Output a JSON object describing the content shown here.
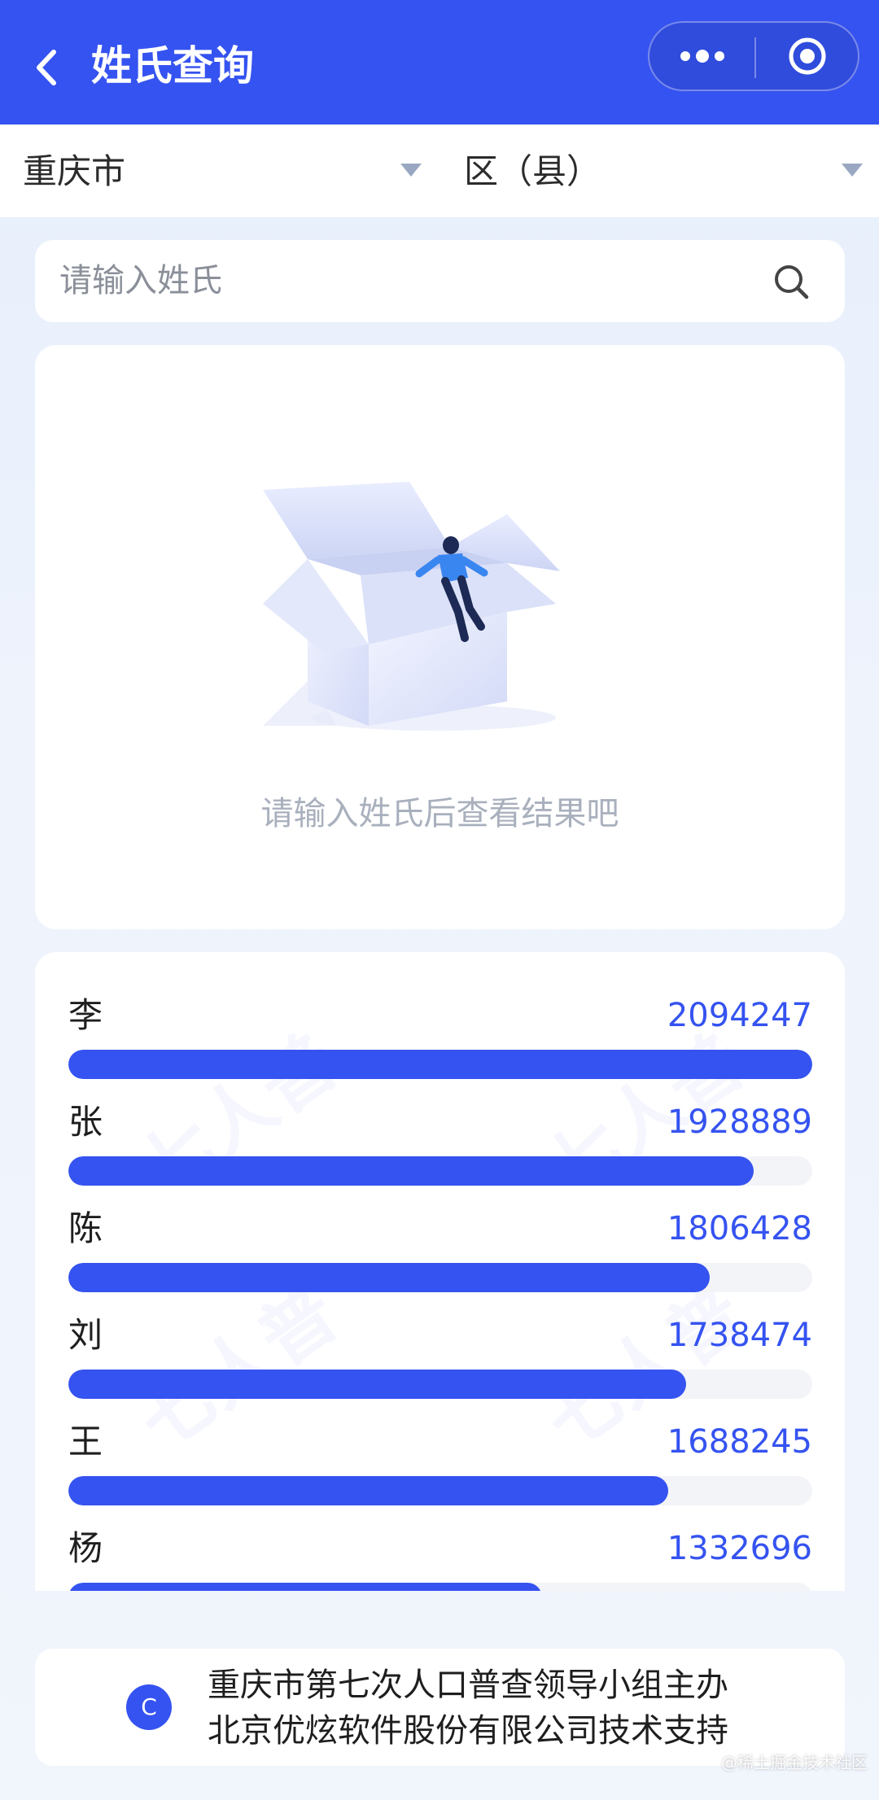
{
  "navbar": {
    "title": "姓氏查询",
    "back_icon": "chevron-left-icon",
    "more_icon": "more-dots-icon",
    "close_icon": "target-circle-icon",
    "color": "#3553f0"
  },
  "filters": {
    "city": "重庆市",
    "district": "区（县）"
  },
  "search": {
    "placeholder": "请输入姓氏",
    "value": ""
  },
  "empty_state": {
    "hint": "请输入姓氏后查看结果吧"
  },
  "ranking": [
    {
      "name": "李",
      "count": "2094247",
      "value": 2094247
    },
    {
      "name": "张",
      "count": "1928889",
      "value": 1928889
    },
    {
      "name": "陈",
      "count": "1806428",
      "value": 1806428
    },
    {
      "name": "刘",
      "count": "1738474",
      "value": 1738474
    },
    {
      "name": "王",
      "count": "1688245",
      "value": 1688245
    },
    {
      "name": "杨",
      "count": "1332696",
      "value": 1332696
    }
  ],
  "footer": {
    "logo_letter": "C",
    "line1": "重庆市第七次人口普查领导小组主办",
    "line2": "北京优炫软件股份有限公司技术支持"
  },
  "credit": "@稀土掘金技术社区",
  "watermark": "七人普",
  "accent_color": "#3553f0"
}
